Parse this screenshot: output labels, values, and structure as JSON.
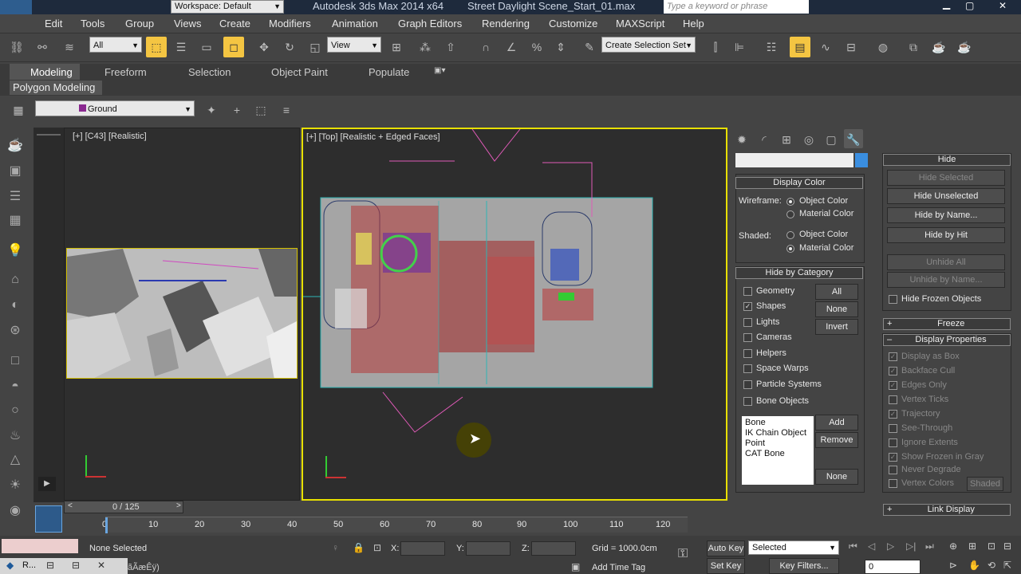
{
  "titlebar": {
    "workspace": "Workspace: Default",
    "app": "Autodesk 3ds Max  2014 x64",
    "file": "Street Daylight Scene_Start_01.max",
    "search_placeholder": "Type a keyword or phrase"
  },
  "menu": [
    "Edit",
    "Tools",
    "Group",
    "Views",
    "Create",
    "Modifiers",
    "Animation",
    "Graph Editors",
    "Rendering",
    "Customize",
    "MAXScript",
    "Help"
  ],
  "toolbar": {
    "filter": "All",
    "refcoord": "View",
    "selection_set": "Create Selection Set"
  },
  "ribbon": {
    "tabs": [
      "Modeling",
      "Freeform",
      "Selection",
      "Object Paint",
      "Populate"
    ],
    "sub": "Polygon Modeling"
  },
  "layer": {
    "name": "Ground"
  },
  "viewports": {
    "left_label": "[+] [C43] [Realistic]",
    "top_label": "[+] [Top] [Realistic + Edged Faces]"
  },
  "display": {
    "display_color": "Display Color",
    "wireframe": "Wireframe:",
    "shaded": "Shaded:",
    "object_color": "Object Color",
    "material_color": "Material Color",
    "hide_by_category": "Hide by Category",
    "categories": [
      "Geometry",
      "Shapes",
      "Lights",
      "Cameras",
      "Helpers",
      "Space Warps",
      "Particle Systems",
      "Bone Objects"
    ],
    "all": "All",
    "none": "None",
    "invert": "Invert",
    "list": [
      "Bone",
      "IK Chain Object",
      "Point",
      "CAT Bone"
    ],
    "add": "Add",
    "remove": "Remove",
    "none2": "None"
  },
  "hide": {
    "title": "Hide",
    "hide_selected": "Hide Selected",
    "hide_unselected": "Hide Unselected",
    "hide_by_name": "Hide by Name...",
    "hide_by_hit": "Hide by Hit",
    "unhide_all": "Unhide All",
    "unhide_by_name": "Unhide by Name...",
    "hide_frozen": "Hide Frozen Objects",
    "freeze": "Freeze",
    "display_props": "Display Properties",
    "props": [
      "Display as Box",
      "Backface Cull",
      "Edges Only",
      "Vertex Ticks",
      "Trajectory",
      "See-Through",
      "Ignore Extents",
      "Show Frozen in Gray",
      "Never Degrade",
      "Vertex Colors"
    ],
    "shaded": "Shaded",
    "link_display": "Link Display"
  },
  "timeline": {
    "counter": "0 / 125",
    "ticks": [
      "0",
      "10",
      "20",
      "30",
      "40",
      "50",
      "60",
      "70",
      "80",
      "90",
      "100",
      "110",
      "120"
    ]
  },
  "status": {
    "none_selected": "None Selected",
    "x": "X:",
    "y": "Y:",
    "z": "Z:",
    "grid": "Grid = 1000.0cm",
    "auto_key": "Auto Key",
    "selected": "Selected",
    "set_key": "Set Key",
    "key_filters": "Key Filters...",
    "add_time_tag": "Add Time Tag",
    "frame": "0",
    "task1": "R...",
    "task2": "ãÃæÊÿ)"
  }
}
